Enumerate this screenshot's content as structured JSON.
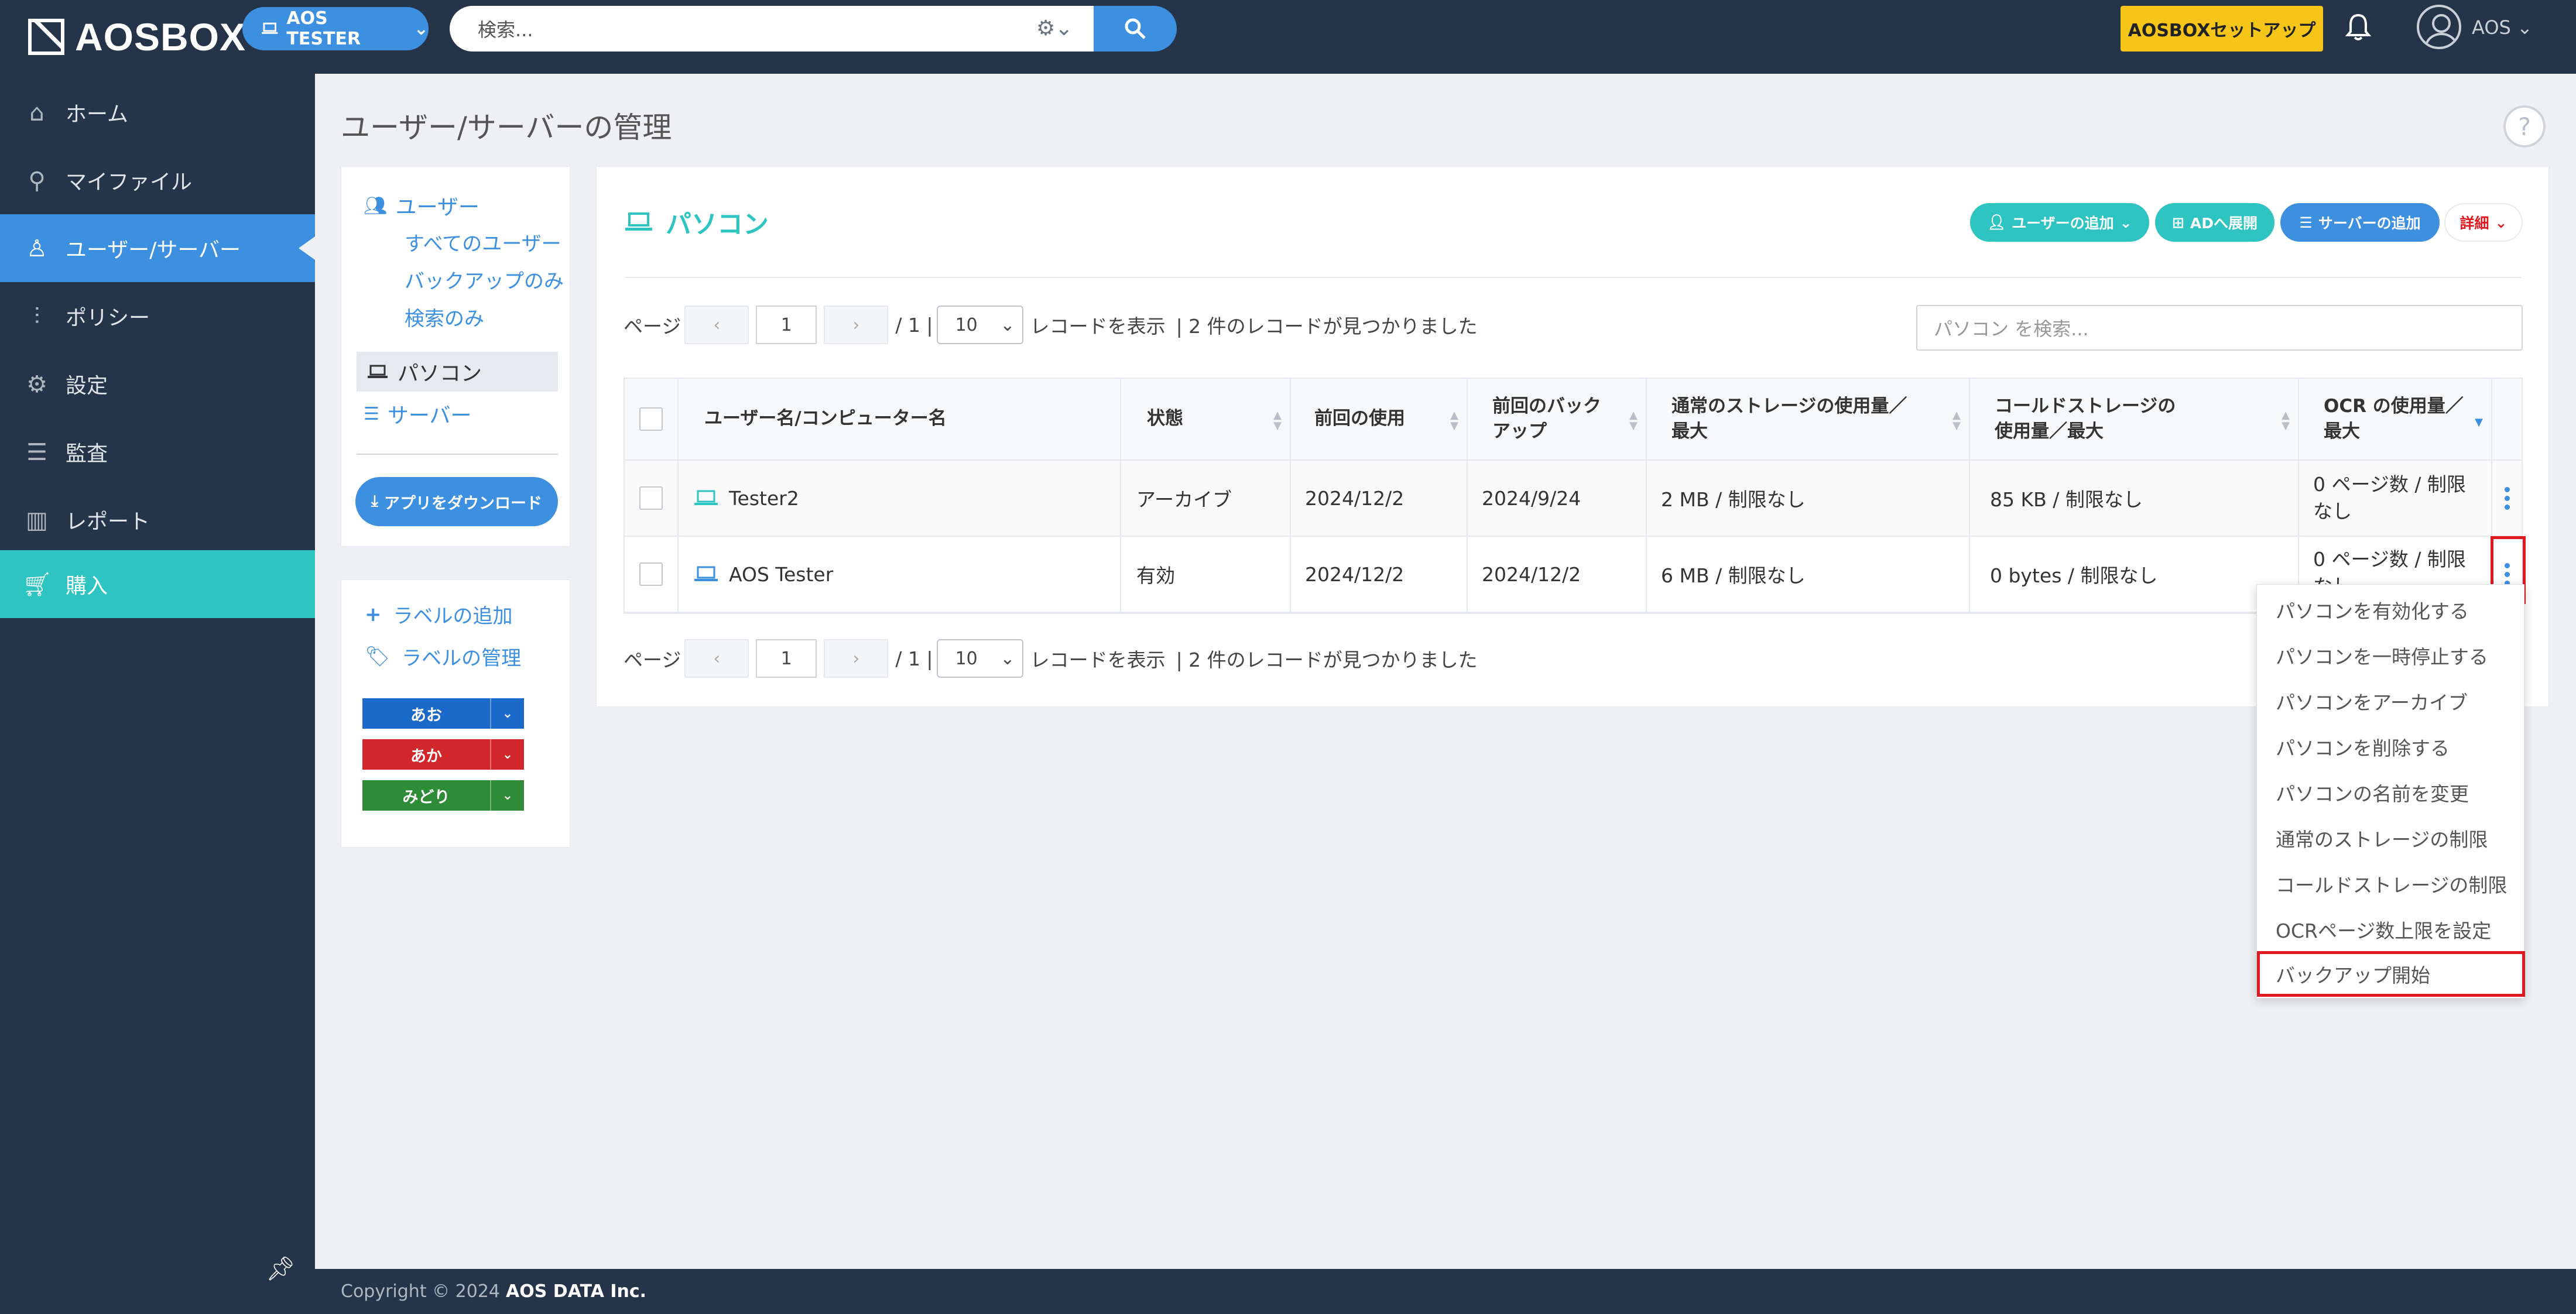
{
  "app": {
    "name": "AOSBOX"
  },
  "topbar": {
    "tenant": "AOS TESTER",
    "search_placeholder": "検索...",
    "setup_button": "AOSBOXセットアップ",
    "user": "AOS"
  },
  "sidebar": {
    "items": [
      {
        "label": "ホーム",
        "icon": "home-icon"
      },
      {
        "label": "マイファイル",
        "icon": "search-icon"
      },
      {
        "label": "ユーザー/サーバー",
        "icon": "user-icon",
        "active": true
      },
      {
        "label": "ポリシー",
        "icon": "sliders-icon"
      },
      {
        "label": "設定",
        "icon": "gear-icon"
      },
      {
        "label": "監査",
        "icon": "list-icon"
      },
      {
        "label": "レポート",
        "icon": "bar-chart-icon"
      },
      {
        "label": "購入",
        "icon": "cart-icon"
      }
    ]
  },
  "page": {
    "title": "ユーザー/サーバーの管理"
  },
  "tree": {
    "users_label": "ユーザー",
    "all_users": "すべてのユーザー",
    "backup_only": "バックアップのみ",
    "search_only": "検索のみ",
    "computers": "パソコン",
    "servers": "サーバー",
    "download_button": "アプリをダウンロード"
  },
  "labels": {
    "add": "ラベルの追加",
    "manage": "ラベルの管理",
    "items": [
      {
        "name": "あお",
        "color": "#1b6ac9"
      },
      {
        "name": "あか",
        "color": "#d1262a"
      },
      {
        "name": "みどり",
        "color": "#2e8b36"
      }
    ]
  },
  "main": {
    "title": "パソコン",
    "actions": {
      "add_user": "ユーザーの追加",
      "ad_deploy": "ADへ展開",
      "add_server": "サーバーの追加",
      "details": "詳細"
    },
    "pager": {
      "page_label": "ページ",
      "prev": "‹",
      "next": "›",
      "current": "1",
      "total": "/ 1 |",
      "per_page": "10",
      "records_label": "レコードを表示",
      "found": "| 2 件のレコードが見つかりました"
    },
    "search_placeholder": "パソコン を検索...",
    "table": {
      "headers": [
        "ユーザー名/コンピューター名",
        "状態",
        "前回の使用",
        "前回のバックアップ",
        "通常のストレージの使用量／最大",
        "コールドストレージの使用量／最大",
        "OCR の使用量／最大"
      ],
      "rows": [
        {
          "name": "Tester2",
          "status": "アーカイブ",
          "last_used": "2024/12/2",
          "last_backup": "2024/9/24",
          "storage": "2 MB / 制限なし",
          "cold": "85 KB / 制限なし",
          "ocr": "0 ページ数 / 制限なし"
        },
        {
          "name": "AOS Tester",
          "status": "有効",
          "last_used": "2024/12/2",
          "last_backup": "2024/12/2",
          "storage": "6 MB / 制限なし",
          "cold": "0 bytes / 制限なし",
          "ocr": "0 ページ数 / 制限なし"
        }
      ]
    }
  },
  "context_menu": {
    "items": [
      "パソコンを有効化する",
      "パソコンを一時停止する",
      "パソコンをアーカイブ",
      "パソコンを削除する",
      "パソコンの名前を変更",
      "通常のストレージの制限",
      "コールドストレージの制限",
      "OCRページ数上限を設定",
      "バックアップ開始"
    ]
  },
  "footer": {
    "prefix": "Copyright © 2024",
    "company": "AOS DATA Inc."
  },
  "colors": {
    "navy": "#263449",
    "blue": "#3d8fe0",
    "teal": "#2ec4c1",
    "yellow": "#f6c519",
    "highlight": "#e0191f"
  }
}
